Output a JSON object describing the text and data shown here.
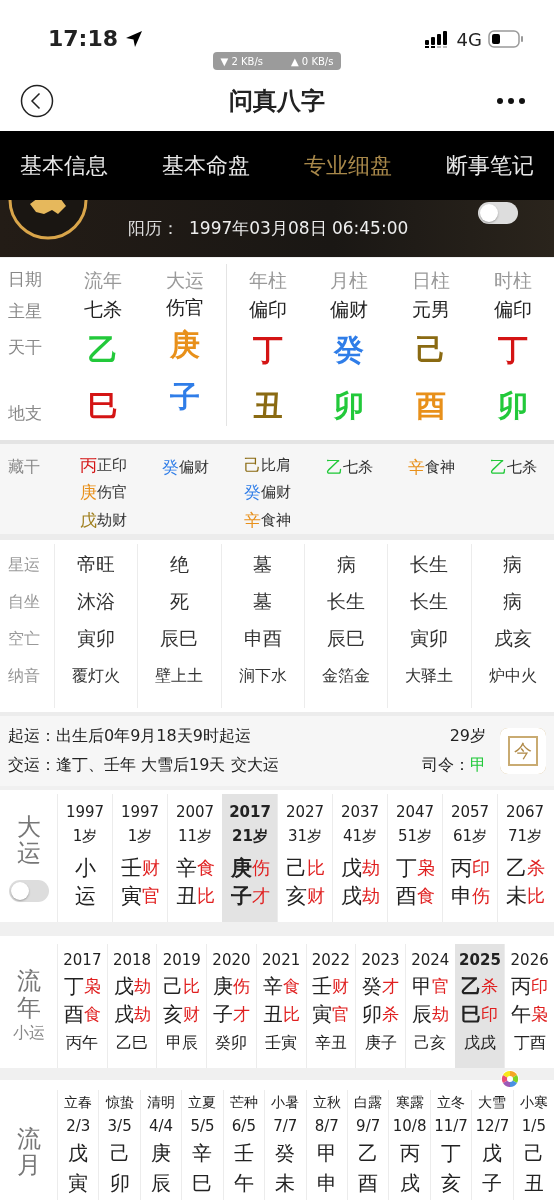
{
  "status_bar": {
    "time": "17:18",
    "network": "4G",
    "speed_down": "▼ 2 KB/s",
    "speed_up": "▲ 0 KB/s"
  },
  "nav": {
    "title": "问真八字"
  },
  "tabs": [
    {
      "label": "基本信息",
      "selected": false
    },
    {
      "label": "基本命盘",
      "selected": false
    },
    {
      "label": "专业细盘",
      "selected": true
    },
    {
      "label": "断事笔记",
      "selected": false
    }
  ],
  "header": {
    "solar_label": "阳历：",
    "solar_date": "1997年03月08日 06:45:00",
    "toggle_on": false
  },
  "pillars": {
    "row_labels": [
      "日期",
      "主星",
      "天干",
      "地支"
    ],
    "columns": [
      {
        "head": "流年",
        "star": "七杀",
        "stem": {
          "text": "乙",
          "color": "#22c93a"
        },
        "branch": {
          "text": "巳",
          "color": "#d41414"
        }
      },
      {
        "head": "大运",
        "star": "伤官",
        "stem": {
          "text": "庚",
          "color": "#e8901a"
        },
        "branch": {
          "text": "子",
          "color": "#2f7de8"
        }
      },
      {
        "head": "年柱",
        "star": "偏印",
        "stem": {
          "text": "丁",
          "color": "#d41414"
        },
        "branch": {
          "text": "丑",
          "color": "#8a6a12"
        }
      },
      {
        "head": "月柱",
        "star": "偏财",
        "stem": {
          "text": "癸",
          "color": "#2f7de8"
        },
        "branch": {
          "text": "卯",
          "color": "#22c93a"
        }
      },
      {
        "head": "日柱",
        "star": "元男",
        "stem": {
          "text": "己",
          "color": "#8a6a12"
        },
        "branch": {
          "text": "酉",
          "color": "#e8901a"
        }
      },
      {
        "head": "时柱",
        "star": "偏印",
        "stem": {
          "text": "丁",
          "color": "#d41414"
        },
        "branch": {
          "text": "卯",
          "color": "#22c93a"
        }
      }
    ]
  },
  "hidden_stems": {
    "label": "藏干",
    "columns": [
      [
        {
          "stem": "丙",
          "color": "#d41414",
          "god": "正印"
        },
        {
          "stem": "庚",
          "color": "#e8901a",
          "god": "伤官"
        },
        {
          "stem": "戊",
          "color": "#a08020",
          "god": "劫财"
        }
      ],
      [
        {
          "stem": "癸",
          "color": "#2f7de8",
          "god": "偏财"
        }
      ],
      [
        {
          "stem": "己",
          "color": "#8a6a12",
          "god": "比肩"
        },
        {
          "stem": "癸",
          "color": "#2f7de8",
          "god": "偏财"
        },
        {
          "stem": "辛",
          "color": "#e8901a",
          "god": "食神"
        }
      ],
      [
        {
          "stem": "乙",
          "color": "#22c93a",
          "god": "七杀"
        }
      ],
      [
        {
          "stem": "辛",
          "color": "#e8901a",
          "god": "食神"
        }
      ],
      [
        {
          "stem": "乙",
          "color": "#22c93a",
          "god": "七杀"
        }
      ]
    ]
  },
  "stages": {
    "row_labels": [
      "星运",
      "自坐",
      "空亡",
      "纳音"
    ],
    "columns": [
      [
        "帝旺",
        "沐浴",
        "寅卯",
        "覆灯火"
      ],
      [
        "绝",
        "死",
        "辰巳",
        "壁上土"
      ],
      [
        "墓",
        "墓",
        "申酉",
        "涧下水"
      ],
      [
        "病",
        "长生",
        "辰巳",
        "金箔金"
      ],
      [
        "长生",
        "长生",
        "寅卯",
        "大驿土"
      ],
      [
        "病",
        "病",
        "戌亥",
        "炉中火"
      ]
    ]
  },
  "luck_info": {
    "start_label": "起运：",
    "start_text": "出生后0年9月18天9时起运",
    "change_label": "交运：",
    "change_text": "逢丁、壬年 大雪后19天 交大运",
    "age": "29岁",
    "commander_label": "司令：",
    "commander": {
      "text": "甲",
      "color": "#22c93a"
    },
    "today_button": "今"
  },
  "dayun": {
    "label": "大运",
    "toggle_on": false,
    "items": [
      {
        "year": "1997",
        "age": "1岁",
        "stem": "小",
        "branch": "运",
        "selected": false
      },
      {
        "year": "1997",
        "age": "1岁",
        "stem": "壬",
        "stem_god": "财",
        "branch": "寅",
        "branch_god": "官",
        "selected": false
      },
      {
        "year": "2007",
        "age": "11岁",
        "stem": "辛",
        "stem_god": "食",
        "branch": "丑",
        "branch_god": "比",
        "selected": false
      },
      {
        "year": "2017",
        "age": "21岁",
        "stem": "庚",
        "stem_god": "伤",
        "branch": "子",
        "branch_god": "才",
        "selected": true
      },
      {
        "year": "2027",
        "age": "31岁",
        "stem": "己",
        "stem_god": "比",
        "branch": "亥",
        "branch_god": "财",
        "selected": false
      },
      {
        "year": "2037",
        "age": "41岁",
        "stem": "戊",
        "stem_god": "劫",
        "branch": "戌",
        "branch_god": "劫",
        "selected": false
      },
      {
        "year": "2047",
        "age": "51岁",
        "stem": "丁",
        "stem_god": "枭",
        "branch": "酉",
        "branch_god": "食",
        "selected": false
      },
      {
        "year": "2057",
        "age": "61岁",
        "stem": "丙",
        "stem_god": "印",
        "branch": "申",
        "branch_god": "伤",
        "selected": false
      },
      {
        "year": "2067",
        "age": "71岁",
        "stem": "乙",
        "stem_god": "杀",
        "branch": "未",
        "branch_god": "比",
        "selected": false
      }
    ]
  },
  "liunian": {
    "label": "流年",
    "sublabel": "小运",
    "items": [
      {
        "year": "2017",
        "stem": "丁",
        "stem_god": "枭",
        "branch": "酉",
        "branch_god": "食",
        "minor": "丙午",
        "selected": false
      },
      {
        "year": "2018",
        "stem": "戊",
        "stem_god": "劫",
        "branch": "戌",
        "branch_god": "劫",
        "minor": "乙巳",
        "selected": false
      },
      {
        "year": "2019",
        "stem": "己",
        "stem_god": "比",
        "branch": "亥",
        "branch_god": "财",
        "minor": "甲辰",
        "selected": false
      },
      {
        "year": "2020",
        "stem": "庚",
        "stem_god": "伤",
        "branch": "子",
        "branch_god": "才",
        "minor": "癸卯",
        "selected": false
      },
      {
        "year": "2021",
        "stem": "辛",
        "stem_god": "食",
        "branch": "丑",
        "branch_god": "比",
        "minor": "壬寅",
        "selected": false
      },
      {
        "year": "2022",
        "stem": "壬",
        "stem_god": "财",
        "branch": "寅",
        "branch_god": "官",
        "minor": "辛丑",
        "selected": false
      },
      {
        "year": "2023",
        "stem": "癸",
        "stem_god": "才",
        "branch": "卯",
        "branch_god": "杀",
        "minor": "庚子",
        "selected": false
      },
      {
        "year": "2024",
        "stem": "甲",
        "stem_god": "官",
        "branch": "辰",
        "branch_god": "劫",
        "minor": "己亥",
        "selected": false
      },
      {
        "year": "2025",
        "stem": "乙",
        "stem_god": "杀",
        "branch": "巳",
        "branch_god": "印",
        "minor": "戊戌",
        "selected": true
      },
      {
        "year": "2026",
        "stem": "丙",
        "stem_god": "印",
        "branch": "午",
        "branch_god": "枭",
        "minor": "丁酉",
        "selected": false
      }
    ]
  },
  "liuyue": {
    "label": "流月",
    "items": [
      {
        "term": "立春",
        "date": "2/3",
        "stem": "戊",
        "branch": "寅"
      },
      {
        "term": "惊蛰",
        "date": "3/5",
        "stem": "己",
        "branch": "卯"
      },
      {
        "term": "清明",
        "date": "4/4",
        "stem": "庚",
        "branch": "辰"
      },
      {
        "term": "立夏",
        "date": "5/5",
        "stem": "辛",
        "branch": "巳"
      },
      {
        "term": "芒种",
        "date": "6/5",
        "stem": "壬",
        "branch": "午"
      },
      {
        "term": "小暑",
        "date": "7/7",
        "stem": "癸",
        "branch": "未"
      },
      {
        "term": "立秋",
        "date": "8/7",
        "stem": "甲",
        "branch": "申"
      },
      {
        "term": "白露",
        "date": "9/7",
        "stem": "乙",
        "branch": "酉"
      },
      {
        "term": "寒露",
        "date": "10/8",
        "stem": "丙",
        "branch": "戌"
      },
      {
        "term": "立冬",
        "date": "11/7",
        "stem": "丁",
        "branch": "亥"
      },
      {
        "term": "大雪",
        "date": "12/7",
        "stem": "戊",
        "branch": "子"
      },
      {
        "term": "小寒",
        "date": "1/5",
        "stem": "己",
        "branch": "丑"
      }
    ]
  }
}
